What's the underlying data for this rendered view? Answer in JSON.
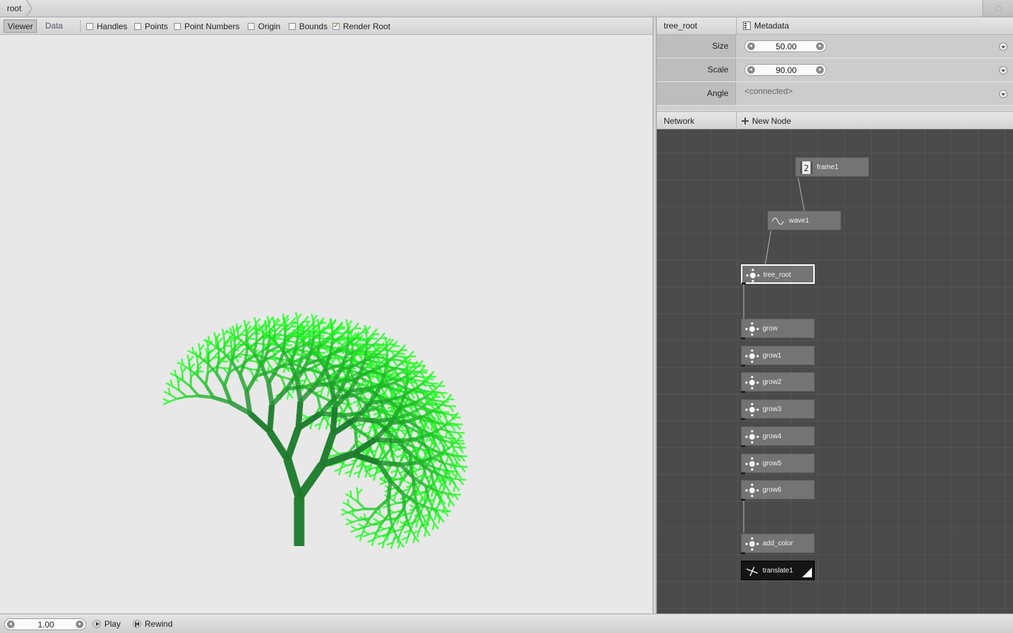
{
  "breadcrumb": {
    "root": "root"
  },
  "viewer": {
    "tabs": {
      "viewer": "Viewer",
      "data": "Data"
    },
    "options": [
      {
        "label": "Handles",
        "checked": false
      },
      {
        "label": "Points",
        "checked": false
      },
      {
        "label": "Point Numbers",
        "checked": false
      },
      {
        "label": "Origin",
        "checked": false
      },
      {
        "label": "Bounds",
        "checked": false
      },
      {
        "label": "Render Root",
        "checked": true
      }
    ],
    "colors": {
      "trunk": "#1a7a2a",
      "foliage": "#18d618",
      "foliage_bright": "#22ff22"
    }
  },
  "parameters": {
    "node_name": "tree_root",
    "metadata_label": "Metadata",
    "size": {
      "label": "Size",
      "value": "50.00"
    },
    "scale": {
      "label": "Scale",
      "value": "90.00"
    },
    "angle": {
      "label": "Angle",
      "value": "<connected>"
    }
  },
  "network": {
    "title": "Network",
    "new_node_label": "New Node",
    "nodes": {
      "frame1": "frame1",
      "wave1": "wave1",
      "tree_root": "tree_root",
      "grow": "grow",
      "grow1": "grow1",
      "grow2": "grow2",
      "grow3": "grow3",
      "grow4": "grow4",
      "grow5": "grow5",
      "grow6": "grow6",
      "add_color": "add_color",
      "translate1": "translate1"
    }
  },
  "playback": {
    "frame": "1.00",
    "play_label": "Play",
    "rewind_label": "Rewind"
  }
}
